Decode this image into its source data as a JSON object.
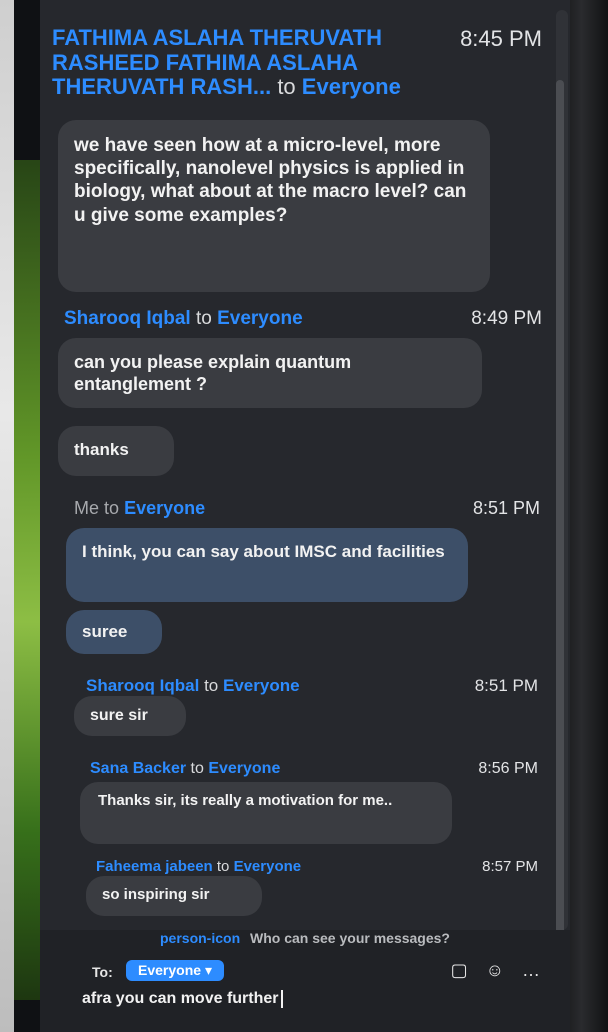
{
  "messages": [
    {
      "sender": "FATHIMA ASLAHA THERUVATH RASHEED FATHIMA ASLAHA THERUVATH RASH...",
      "to": "to",
      "recipient": "Everyone",
      "time": "8:45 PM",
      "bubbles": [
        "we have seen how at a micro-level, more specifically, nanolevel physics is applied in biology, what about at the macro level? can u give some examples?"
      ]
    },
    {
      "sender": "Sharooq Iqbal",
      "to": "to",
      "recipient": "Everyone",
      "time": "8:49 PM",
      "bubbles": [
        "can you please explain quantum entanglement ?",
        "thanks"
      ]
    },
    {
      "sender": "Me",
      "to": "to",
      "recipient": "Everyone",
      "time": "8:51 PM",
      "bubbles": [
        "I think, you can say about IMSC and facilities",
        "suree"
      ]
    },
    {
      "sender": "Sharooq Iqbal",
      "to": "to",
      "recipient": "Everyone",
      "time": "8:51 PM",
      "bubbles": [
        "sure sir"
      ]
    },
    {
      "sender": "Sana Backer",
      "to": "to",
      "recipient": "Everyone",
      "time": "8:56 PM",
      "bubbles": [
        "Thanks sir, its really a motivation for me.."
      ]
    },
    {
      "sender": "Faheema jabeen",
      "to": "to",
      "recipient": "Everyone",
      "time": "8:57 PM",
      "bubbles": [
        "so inspiring sir"
      ]
    }
  ],
  "footer": {
    "who_can_see": "Who can see your messages?",
    "to_label": "To:",
    "recipient": "Everyone",
    "input_value": "afra you can move further"
  },
  "icons": {
    "people": "person-icon",
    "file": "file-icon",
    "emoji": "emoji-icon",
    "more": "more-icon"
  },
  "colors": {
    "accent": "#2d8cff",
    "panel_bg": "#26282d",
    "bubble": "#3a3c41",
    "bubble_mine": "#3d4f68"
  }
}
